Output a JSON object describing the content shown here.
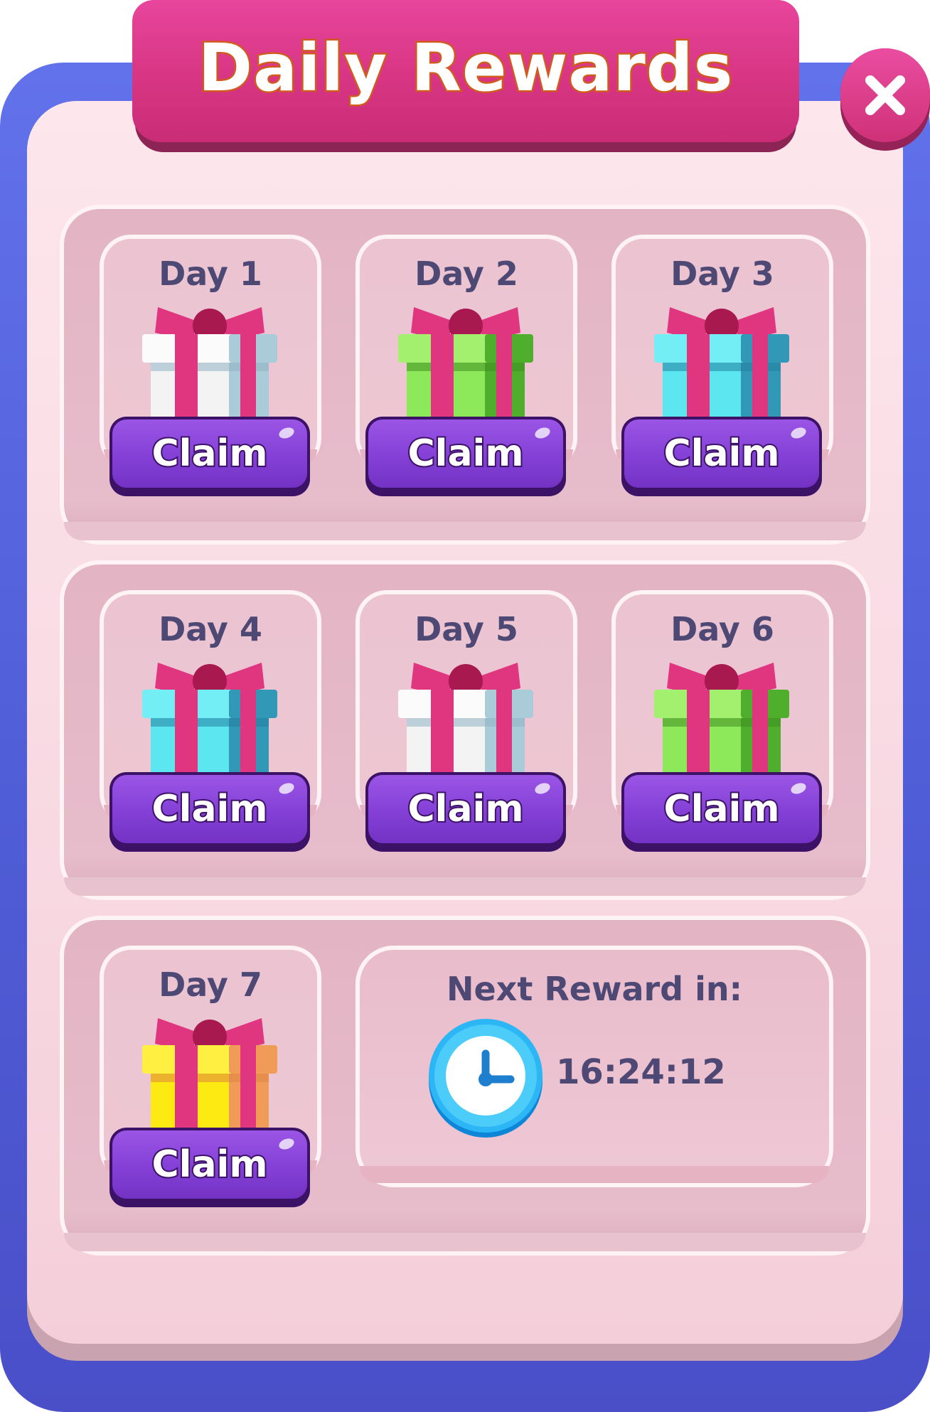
{
  "window": {
    "title": "Daily Rewards",
    "close_icon": "close-icon"
  },
  "rewards": [
    {
      "day": "Day 1",
      "gift_color": "white",
      "claim_label": "Claim"
    },
    {
      "day": "Day 2",
      "gift_color": "green",
      "claim_label": "Claim"
    },
    {
      "day": "Day 3",
      "gift_color": "cyan",
      "claim_label": "Claim"
    },
    {
      "day": "Day 4",
      "gift_color": "cyan",
      "claim_label": "Claim"
    },
    {
      "day": "Day 5",
      "gift_color": "white",
      "claim_label": "Claim"
    },
    {
      "day": "Day 6",
      "gift_color": "green",
      "claim_label": "Claim"
    },
    {
      "day": "Day 7",
      "gift_color": "yellow",
      "claim_label": "Claim"
    }
  ],
  "next_reward": {
    "label": "Next Reward in:",
    "time": "16:24:12",
    "icon": "clock-icon"
  },
  "colors": {
    "frame": "#5666e0",
    "panel": "#fbe0e8",
    "title_tab": "#dc3a8a",
    "claim_button": "#8a45dc",
    "text": "#4e4875",
    "ribbon": "#e0357f"
  }
}
